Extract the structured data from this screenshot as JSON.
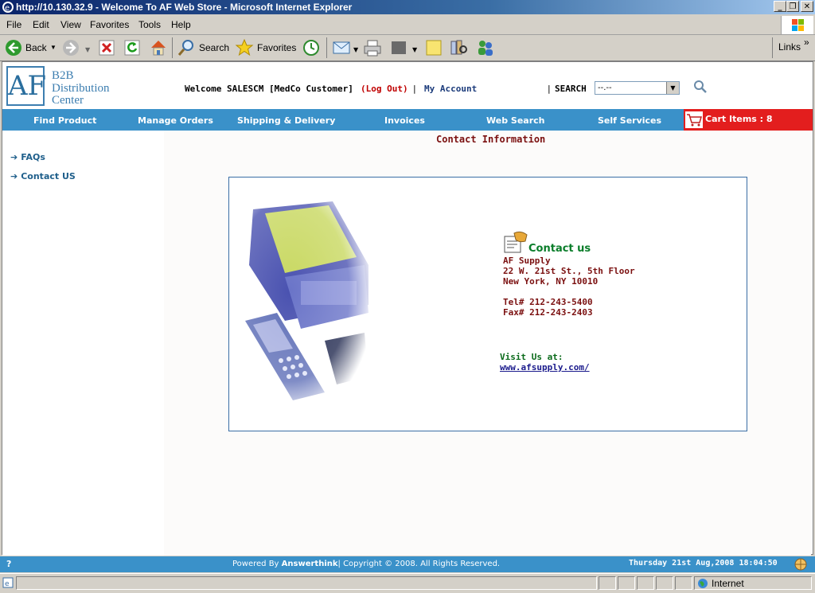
{
  "window": {
    "title": "http://10.130.32.9 - Welcome To AF Web Store - Microsoft Internet Explorer",
    "minimize_glyph": "_",
    "restore_glyph": "❐",
    "close_glyph": "✕"
  },
  "menubar": {
    "items": [
      "File",
      "Edit",
      "View",
      "Favorites",
      "Tools",
      "Help"
    ]
  },
  "toolbar": {
    "back_label": "Back",
    "search_label": "Search",
    "favorites_label": "Favorites",
    "links_label": "Links",
    "chevron": "»"
  },
  "site": {
    "logo_mark": "AF",
    "logo_lines": [
      "B2B",
      "Distribution",
      "Center"
    ],
    "welcome_text": "Welcome SALESCM [MedCo Customer]",
    "logout_label": "(Log Out)",
    "separator": "|",
    "my_account_label": "My Account",
    "search_label": "SEARCH",
    "search_select_value": "--.--"
  },
  "nav": {
    "items": [
      "Find Product",
      "Manage Orders",
      "Shipping & Delivery",
      "Invoices",
      "Web Search",
      "Self Services"
    ],
    "cart_label": "Cart Items : 8"
  },
  "sidebar": {
    "items": [
      "FAQs",
      "Contact US"
    ]
  },
  "content": {
    "heading": "Contact Information",
    "contact_title": "Contact us",
    "company": "AF Supply",
    "address_line1": "22 W. 21st St., 5th Floor",
    "address_line2": "New York, NY 10010",
    "tel": "Tel# 212-243-5400",
    "fax": "Fax# 212-243-2403",
    "visit_label": "Visit Us at:",
    "website": "www.afsupply.com/"
  },
  "footer": {
    "help_glyph": "?",
    "powered_prefix": "Powered By ",
    "powered_brand": "Answerthink",
    "powered_suffix": "| Copyright © 2008. All Rights Reserved.",
    "datetime": "Thursday 21st Aug,2008 18:04:50"
  },
  "statusbar": {
    "zone": "Internet"
  },
  "colors": {
    "nav_blue": "#3a91c9",
    "cart_red": "#e31e1e",
    "heading_maroon": "#7b1010",
    "contact_green": "#0a7d2a"
  }
}
